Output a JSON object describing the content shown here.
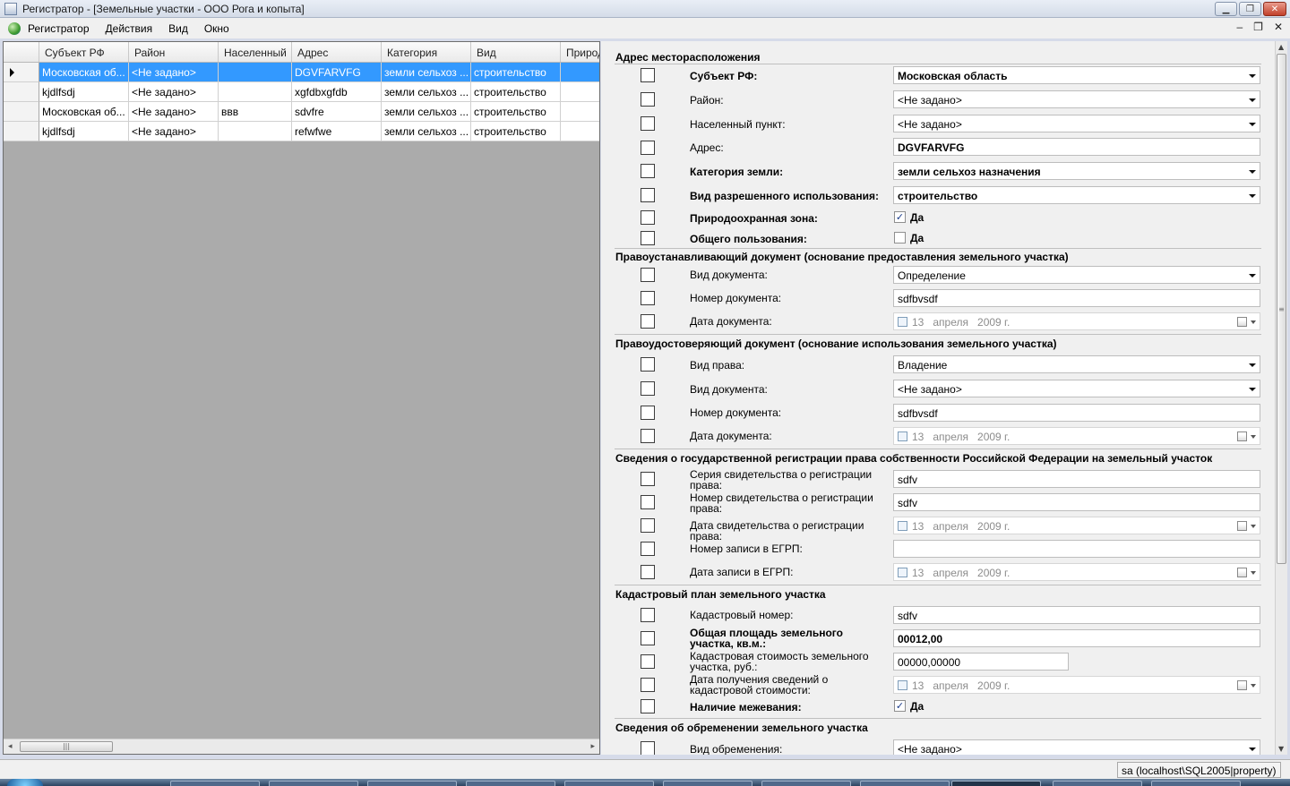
{
  "window": {
    "title": "Регистратор - [Земельные участки - ООО Рога и копыта]"
  },
  "menu": {
    "items": [
      "Регистратор",
      "Действия",
      "Вид",
      "Окно"
    ]
  },
  "grid": {
    "columns": [
      "Субъект РФ",
      "Район",
      "Населенный",
      "Адрес",
      "Категория",
      "Вид",
      "Природ"
    ],
    "rows": [
      [
        "Московская об...",
        "<Не задано>",
        "",
        "DGVFARVFG",
        "земли сельхоз ...",
        "строительство",
        ""
      ],
      [
        "kjdlfsdj",
        "<Не задано>",
        "",
        "xgfdbxgfdb",
        "земли сельхоз ...",
        "строительство",
        ""
      ],
      [
        "Московская об...",
        "<Не задано>",
        "ввв",
        "sdvfre",
        "земли сельхоз ...",
        "строительство",
        ""
      ],
      [
        "kjdlfsdj",
        "<Не задано>",
        "",
        "refwfwe",
        "земли сельхоз ...",
        "строительство",
        ""
      ]
    ]
  },
  "form": {
    "sections": [
      "Адрес месторасположения",
      "Правоустанавливающий документ (основание предоставления земельного участка)",
      "Правоудостоверяющий документ (основание использования земельного участка)",
      "Сведения о государственной регистрации права собственности Российской Федерации на земельный участок",
      "Кадастровый план земельного участка",
      "Сведения об обременении земельного участка"
    ],
    "address": {
      "subject_label": "Субъект РФ:",
      "subject_value": "Московская область",
      "district_label": "Район:",
      "district_value": "<Не задано>",
      "locality_label": "Населенный пункт:",
      "locality_value": "<Не задано>",
      "address_label": "Адрес:",
      "address_value": "DGVFARVFG",
      "category_label": "Категория земли:",
      "category_value": "земли сельхоз назначения",
      "use_label": "Вид разрешенного использования:",
      "use_value": "строительство",
      "nature_label": "Природоохранная зона:",
      "nature_checked": true,
      "nature_option": "Да",
      "common_label": "Общего пользования:",
      "common_checked": false,
      "common_option": "Да"
    },
    "title_doc": {
      "type_label": "Вид документа:",
      "type_value": "Определение",
      "number_label": "Номер документа:",
      "number_value": "sdfbvsdf",
      "date_label": "Дата документа:",
      "date_day": "13",
      "date_month": "апреля",
      "date_year": "2009 г."
    },
    "cert_doc": {
      "right_label": "Вид права:",
      "right_value": "Владение",
      "type_label": "Вид документа:",
      "type_value": "<Не задано>",
      "number_label": "Номер документа:",
      "number_value": "sdfbvsdf",
      "date_label": "Дата документа:",
      "date_day": "13",
      "date_month": "апреля",
      "date_year": "2009 г."
    },
    "registration": {
      "series_label": "Серия  свидетельства о регистрации права:",
      "series_value": "sdfv",
      "number_label": "Номер свидетельства о регистрации права:",
      "number_value": "sdfv",
      "date_label": "Дата свидетельства о регистрации права:",
      "date_day": "13",
      "date_month": "апреля",
      "date_year": "2009 г.",
      "egrp_number_label": "Номер записи в ЕГРП:",
      "egrp_number_value": "",
      "egrp_date_label": "Дата записи в ЕГРП:",
      "egrp_date_day": "13",
      "egrp_date_month": "апреля",
      "egrp_date_year": "2009 г."
    },
    "cadastre": {
      "number_label": "Кадастровый номер:",
      "number_value": "sdfv",
      "area_label": "Общая площадь земельного участка, кв.м.:",
      "area_value": "00012,00",
      "cost_label": "Кадастровая стоимость земельного участка, руб.:",
      "cost_value": "00000,00000",
      "cost_date_label": "Дата получения сведений о кадастровой стоимости:",
      "cost_date_day": "13",
      "cost_date_month": "апреля",
      "cost_date_year": "2009 г.",
      "survey_label": "Наличие межевания:",
      "survey_checked": true,
      "survey_option": "Да"
    },
    "encumbrance": {
      "type_label": "Вид обременения:",
      "type_value": "<Не задано>"
    }
  },
  "status": {
    "connection": "sa (localhost\\SQL2005|property)"
  }
}
